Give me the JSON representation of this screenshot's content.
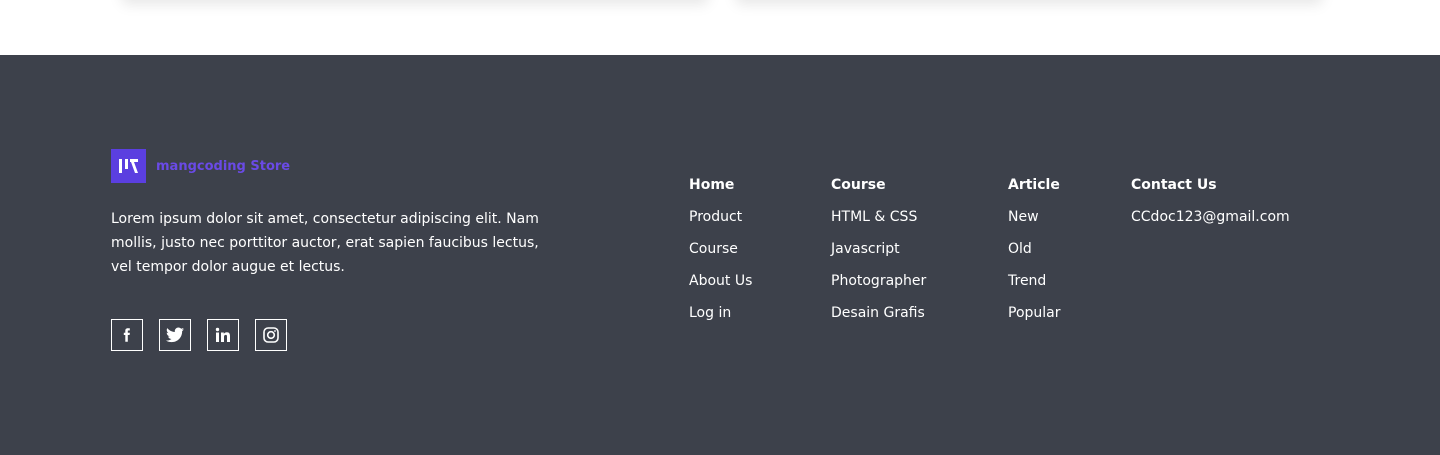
{
  "brand": {
    "name": "mangcoding Store",
    "logo_icon": "mangcoding-logo-icon",
    "logo_color": "#5b3fe0",
    "name_color": "#6a4ae6"
  },
  "about": {
    "text": "Lorem ipsum dolor sit amet, consectetur adipiscing elit. Nam mollis, justo nec porttitor auctor, erat sapien faucibus lectus, vel tempor dolor augue et lectus."
  },
  "socials": [
    {
      "icon": "facebook-icon"
    },
    {
      "icon": "twitter-icon"
    },
    {
      "icon": "linkedin-icon"
    },
    {
      "icon": "instagram-icon"
    }
  ],
  "columns": {
    "home": {
      "title": "Home",
      "items": [
        "Product",
        "Course",
        "About Us",
        "Log in"
      ]
    },
    "course": {
      "title": "Course",
      "items": [
        "HTML & CSS",
        "Javascript",
        "Photographer",
        "Desain Grafis"
      ]
    },
    "article": {
      "title": "Article",
      "items": [
        "New",
        "Old",
        "Trend",
        "Popular"
      ]
    },
    "contact": {
      "title": "Contact Us",
      "items": [
        "CCdoc123@gmail.com"
      ]
    }
  },
  "colors": {
    "footer_bg": "#3d414b",
    "text": "#ffffff"
  }
}
